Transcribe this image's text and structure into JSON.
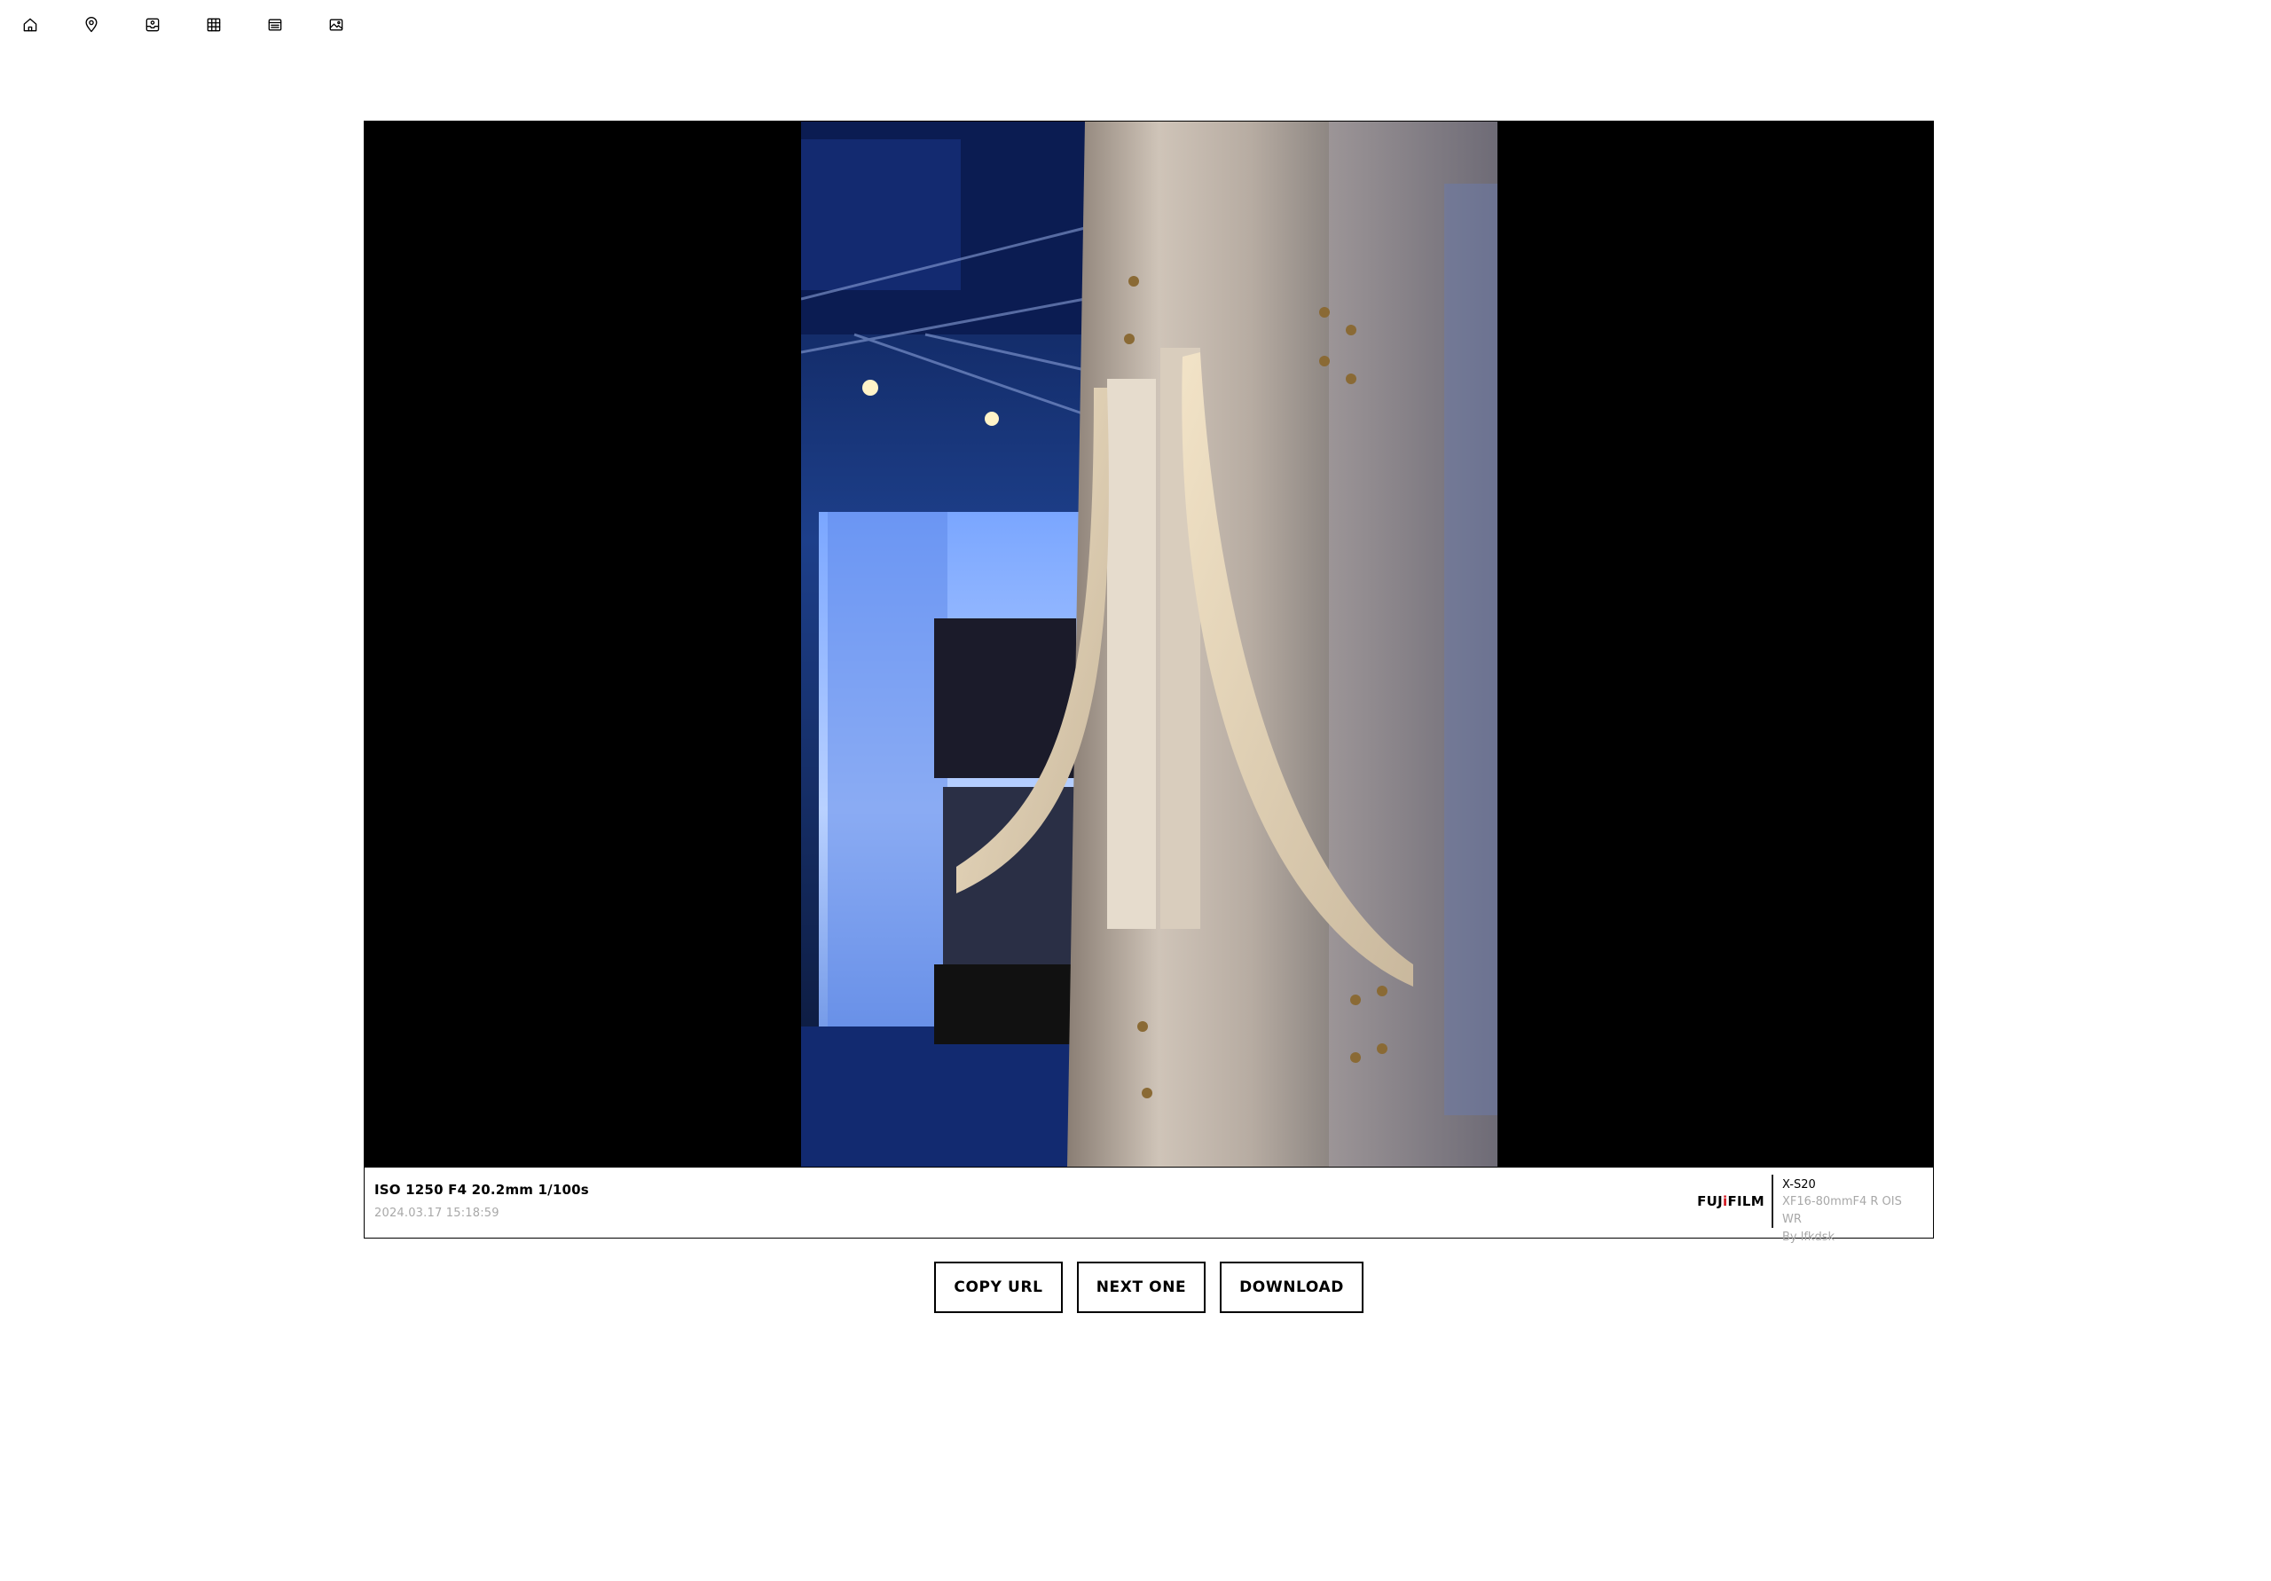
{
  "nav": {
    "items": [
      {
        "name": "home",
        "icon": "home-icon"
      },
      {
        "name": "map",
        "icon": "map-pin-icon"
      },
      {
        "name": "inbox",
        "icon": "inbox-icon"
      },
      {
        "name": "grid",
        "icon": "grid-icon"
      },
      {
        "name": "list",
        "icon": "list-icon"
      },
      {
        "name": "image",
        "icon": "image-icon"
      }
    ]
  },
  "photo": {
    "exif": "ISO 1250 F4 20.2mm 1/100s",
    "datetime": "2024.03.17 15:18:59",
    "brand_pre": "FUJ",
    "brand_i": "i",
    "brand_post": "FILM",
    "camera_model": "X-S20",
    "lens": "XF16-80mmF4 R OIS WR",
    "author": "By lfkdsk"
  },
  "actions": {
    "copy_url": "COPY URL",
    "next_one": "NEXT ONE",
    "download": "DOWNLOAD"
  },
  "colors": {
    "brand_accent": "#d1131c",
    "muted_text": "#a8a8a8"
  }
}
